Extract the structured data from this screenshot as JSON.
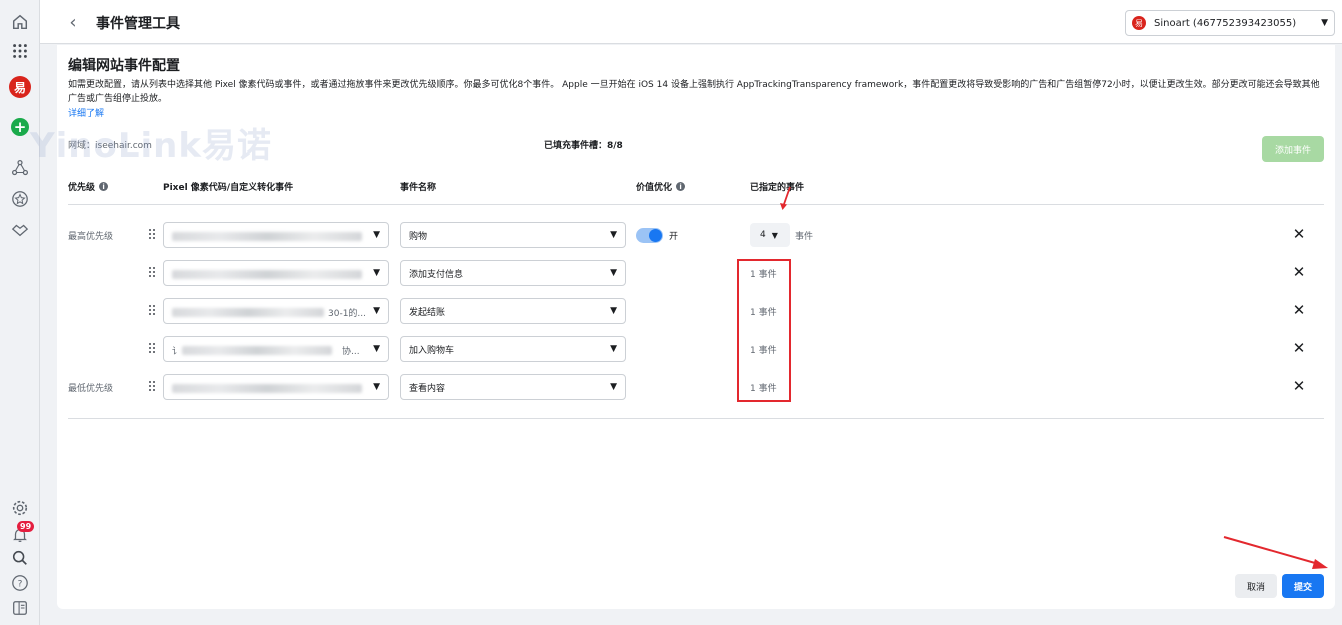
{
  "header": {
    "title": "事件管理工具",
    "account": "Sinoart (467752393423055)"
  },
  "panel": {
    "title": "编辑网站事件配置",
    "description": "如需更改配置，请从列表中选择其他 Pixel 像素代码或事件，或者通过拖放事件来更改优先级顺序。你最多可优化8个事件。 Apple 一旦开始在 iOS 14 设备上强制执行 AppTrackingTransparency framework，事件配置更改将导致受影响的广告和广告组暂停72小时，以便让更改生效。部分更改可能还会导致其他广告或广告组停止投放。",
    "learn_more": "详细了解",
    "domain": "网域：iseehair.com",
    "slots": "已填充事件槽：8/8",
    "add_event": "添加事件"
  },
  "columns": {
    "priority": "优先级",
    "pixel": "Pixel 像素代码/自定义转化事件",
    "event_name": "事件名称",
    "value_opt": "价值优化",
    "assigned": "已指定的事件"
  },
  "rows": [
    {
      "priority": "最高优先级",
      "pixel_suffix": "",
      "event": "购物",
      "value_opt": "开",
      "assigned_count": "4",
      "assigned_suffix": "事件"
    },
    {
      "priority": "",
      "pixel_suffix": "",
      "event": "添加支付信息",
      "assigned": "1 事件"
    },
    {
      "priority": "",
      "pixel_suffix": "30-1的...",
      "event": "发起结账",
      "assigned": "1 事件"
    },
    {
      "priority": "",
      "pixel_prefix": "讠",
      "pixel_suffix": "协...",
      "event": "加入购物车",
      "assigned": "1 事件"
    },
    {
      "priority": "最低优先级",
      "pixel_suffix": "",
      "event": "查看内容",
      "assigned": "1 事件"
    }
  ],
  "footer": {
    "cancel": "取消",
    "submit": "提交"
  },
  "notifications_badge": "99",
  "watermark": "YinoLink易诺",
  "colors": {
    "primary": "#1877f2",
    "add_disabled": "#a8d9a3",
    "annotation": "#e3282e",
    "brand": "#d9241c"
  }
}
